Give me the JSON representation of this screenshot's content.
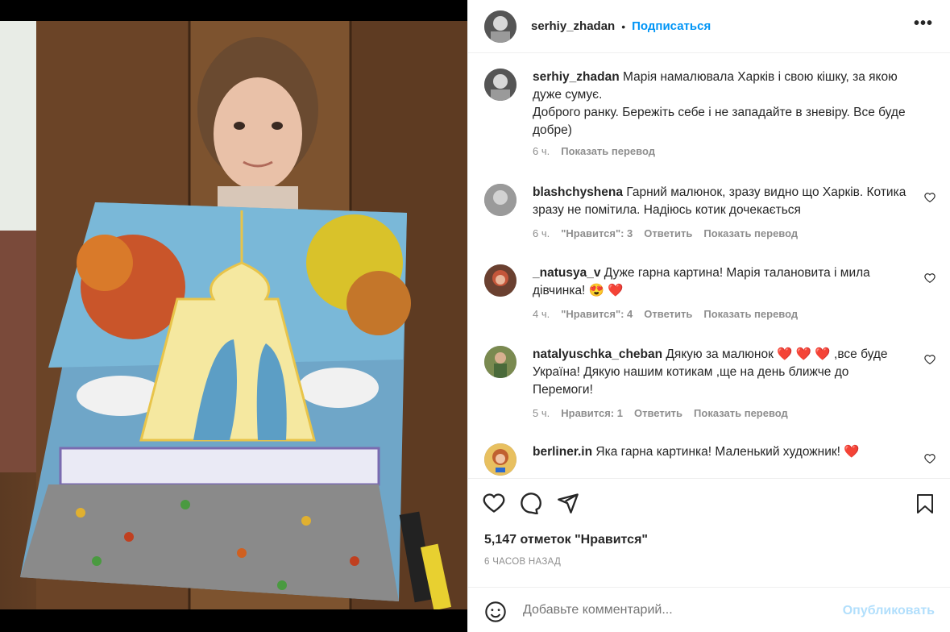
{
  "post": {
    "username": "serhiy_zhadan",
    "separator": "•",
    "follow_label": "Подписаться",
    "more_label": "•••"
  },
  "caption": {
    "username": "serhiy_zhadan",
    "text": "Марія намалювала Харків і свою кішку, за якою дуже сумує.",
    "text2": "Доброго ранку. Бережіть себе і не западайте в зневіру. Все буде добре)",
    "time": "6 ч.",
    "translate": "Показать перевод"
  },
  "comments": [
    {
      "username": "blashchyshena",
      "text": "Гарний малюнок, зразу видно що Харків. Котика зразу не помітила. Надіюсь котик дочекається",
      "time": "6 ч.",
      "likes": "\"Нравится\": 3",
      "reply": "Ответить",
      "translate": "Показать перевод"
    },
    {
      "username": "_natusya_v",
      "text": "Дуже гарна картина! Марія талановита і мила дівчинка!",
      "emoji": "😍 ❤️",
      "time": "4 ч.",
      "likes": "\"Нравится\": 4",
      "reply": "Ответить",
      "translate": "Показать перевод"
    },
    {
      "username": "natalyuschka_cheban",
      "text_a": "Дякую за малюнок",
      "hearts": "❤️ ❤️ ❤️",
      "text_b": ",все буде Україна! Дякую нашим котикам ,ще на день ближче до Перемоги!",
      "time": "5 ч.",
      "likes": "Нравится: 1",
      "reply": "Ответить",
      "translate": "Показать перевод"
    },
    {
      "username": "berliner.in",
      "text": "Яка гарна картинка! Маленький художник!",
      "emoji": "❤️"
    }
  ],
  "likes_count": "5,147 отметок \"Нравится\"",
  "posted_ago": "6 ЧАСОВ НАЗАД",
  "composer": {
    "placeholder": "Добавьте комментарий...",
    "publish_label": "Опубликовать"
  },
  "colors": {
    "accent": "#0095f6",
    "heart": "#ed4956",
    "muted": "#8e8e8e",
    "text": "#262626"
  },
  "icons": [
    "heart-icon",
    "comment-icon",
    "share-icon",
    "bookmark-icon",
    "emoji-icon",
    "more-icon"
  ]
}
